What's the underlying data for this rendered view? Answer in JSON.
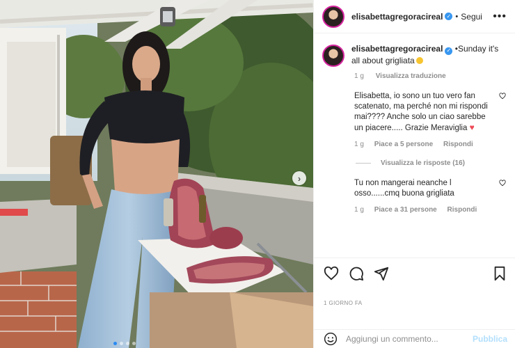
{
  "post": {
    "username": "elisabettagregoracireal",
    "follow_label": "Segui",
    "more_label": "•••",
    "separator": "•",
    "carousel_next": "›",
    "carousel_count": 4,
    "carousel_index": 1
  },
  "caption": {
    "username": "elisabettagregoracireal",
    "text": "•Sunday it's all about grigliata",
    "age": "1 g",
    "translate_label": "Visualizza traduzione"
  },
  "comments": [
    {
      "text": "Elisabetta, io sono un tuo vero fan scatenato, ma perché non mi rispondi mai???? Anche solo un ciao sarebbe un piacere..... Grazie Meraviglia",
      "age": "1 g",
      "likes": "Piace a 5 persone",
      "reply_label": "Rispondi",
      "emoji": "♥"
    },
    {
      "text": "Tu non mangerai neanche l osso......cmq buona grigliata",
      "age": "1 g",
      "likes": "Piace a 31 persone",
      "reply_label": "Rispondi"
    }
  ],
  "replies_toggle": "Visualizza le risposte (16)",
  "timestamp": "1 GIORNO FA",
  "add_comment": {
    "placeholder": "Aggiungi un commento...",
    "publish_label": "Pubblica"
  },
  "colors": {
    "verified": "#3897f0",
    "link_blue": "#b2dffc",
    "heart_red": "#ed4956",
    "story_ring": "#d6249f",
    "carousel_active": "#2a8bf2"
  },
  "icons": [
    "heart-icon",
    "comment-icon",
    "share-icon",
    "bookmark-icon",
    "emoji-icon",
    "verified-icon",
    "chevron-right-icon",
    "more-icon"
  ]
}
